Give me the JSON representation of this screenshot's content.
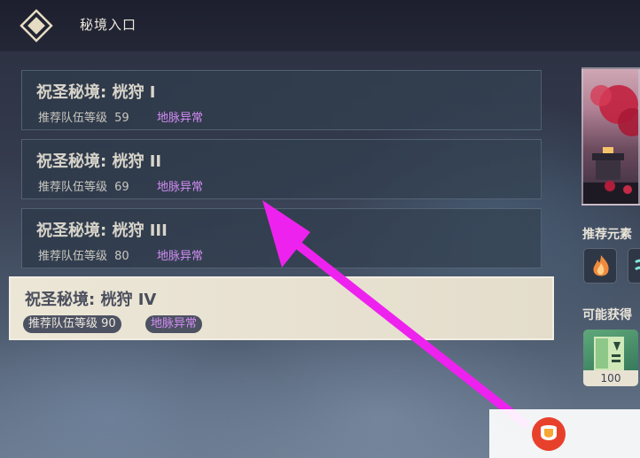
{
  "header": {
    "title": "秘境入口"
  },
  "domains": [
    {
      "name": "祝圣秘境: 桄狩 I",
      "rec_label": "推荐队伍等级",
      "level": "59",
      "badge": "地脉异常",
      "selected": false
    },
    {
      "name": "祝圣秘境: 桄狩 II",
      "rec_label": "推荐队伍等级",
      "level": "69",
      "badge": "地脉异常",
      "selected": false
    },
    {
      "name": "祝圣秘境: 桄狩 III",
      "rec_label": "推荐队伍等级",
      "level": "80",
      "badge": "地脉异常",
      "selected": false
    },
    {
      "name": "祝圣秘境: 桄狩 IV",
      "rec_label": "推荐队伍等级",
      "level": "90",
      "badge": "地脉异常",
      "selected": true
    }
  ],
  "side": {
    "recommended_elements_label": "推荐元素",
    "possible_rewards_label": "可能获得",
    "elements": [
      "pyro-icon",
      "anemo-icon"
    ],
    "reward_count": "100"
  },
  "colors": {
    "accent_purple": "#d48cf5",
    "annotation_arrow": "#ee22ee",
    "selected_bg": "#ece6d7"
  }
}
